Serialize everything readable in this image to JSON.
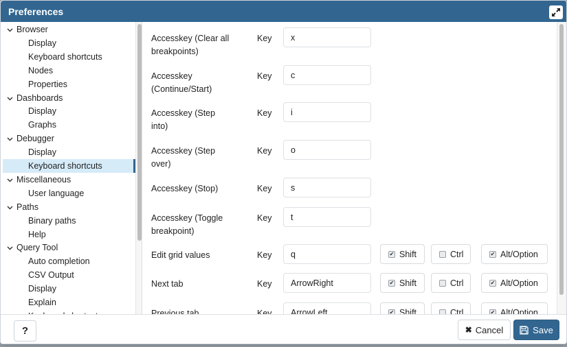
{
  "dialog": {
    "title": "Preferences",
    "maximize_icon": "expand-arrows-icon"
  },
  "sidebar": {
    "items": [
      {
        "label": "Browser",
        "type": "parent",
        "expanded": true
      },
      {
        "label": "Display",
        "type": "child"
      },
      {
        "label": "Keyboard shortcuts",
        "type": "child"
      },
      {
        "label": "Nodes",
        "type": "child"
      },
      {
        "label": "Properties",
        "type": "child"
      },
      {
        "label": "Dashboards",
        "type": "parent",
        "expanded": true
      },
      {
        "label": "Display",
        "type": "child"
      },
      {
        "label": "Graphs",
        "type": "child"
      },
      {
        "label": "Debugger",
        "type": "parent",
        "expanded": true
      },
      {
        "label": "Display",
        "type": "child"
      },
      {
        "label": "Keyboard shortcuts",
        "type": "child",
        "selected": true
      },
      {
        "label": "Miscellaneous",
        "type": "parent",
        "expanded": true
      },
      {
        "label": "User language",
        "type": "child"
      },
      {
        "label": "Paths",
        "type": "parent",
        "expanded": true
      },
      {
        "label": "Binary paths",
        "type": "child"
      },
      {
        "label": "Help",
        "type": "child"
      },
      {
        "label": "Query Tool",
        "type": "parent",
        "expanded": true
      },
      {
        "label": "Auto completion",
        "type": "child"
      },
      {
        "label": "CSV Output",
        "type": "child"
      },
      {
        "label": "Display",
        "type": "child"
      },
      {
        "label": "Explain",
        "type": "child"
      },
      {
        "label": "Keyboard shortcuts",
        "type": "child"
      }
    ],
    "chevron": "⌄"
  },
  "settings": {
    "key_label": "Key",
    "modifiers": {
      "shift": "Shift",
      "ctrl": "Ctrl",
      "alt": "Alt/Option"
    },
    "rows": [
      {
        "label": "Accesskey (Clear all breakpoints)",
        "key": "x"
      },
      {
        "label": "Accesskey (Continue/Start)",
        "key": "c"
      },
      {
        "label": "Accesskey (Step into)",
        "key": "i"
      },
      {
        "label": "Accesskey (Step over)",
        "key": "o"
      },
      {
        "label": "Accesskey (Stop)",
        "key": "s"
      },
      {
        "label": "Accesskey (Toggle breakpoint)",
        "key": "t"
      },
      {
        "label": "Edit grid values",
        "key": "q",
        "shift": true,
        "ctrl": false,
        "alt": true
      },
      {
        "label": "Next tab",
        "key": "ArrowRight",
        "shift": true,
        "ctrl": false,
        "alt": true
      },
      {
        "label": "Previous tab",
        "key": "ArrowLeft",
        "shift": true,
        "ctrl": false,
        "alt": true
      }
    ]
  },
  "footer": {
    "help_label": "?",
    "cancel_label": "Cancel",
    "save_label": "Save"
  },
  "colors": {
    "accent": "#326690",
    "selected_bg": "#d6ebf8"
  }
}
